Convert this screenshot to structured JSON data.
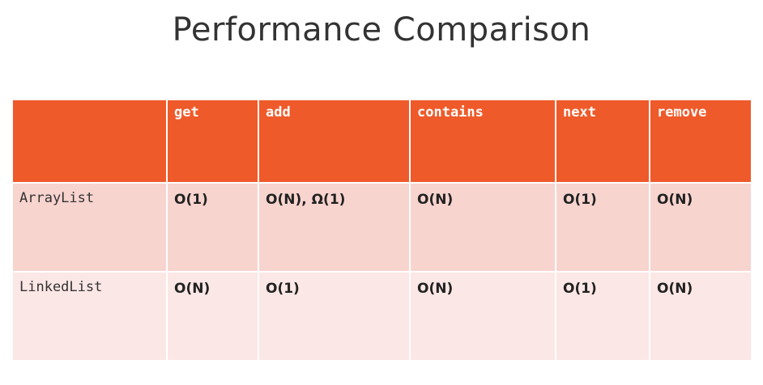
{
  "title": "Performance Comparison",
  "table": {
    "headers": [
      "",
      "get",
      "add",
      "contains",
      "next",
      "remove"
    ],
    "rows": [
      {
        "name": "ArrayList",
        "get": "O(1)",
        "add": "O(N), Ω(1)",
        "contains": "O(N)",
        "next": "O(1)",
        "remove": "O(N)"
      },
      {
        "name": "LinkedList",
        "get": "O(N)",
        "add": "O(1)",
        "contains": "O(N)",
        "next": "O(1)",
        "remove": "O(N)"
      }
    ]
  },
  "colors": {
    "header_bg": "#ef5a2a",
    "row_a_bg": "#f8d4cf",
    "row_b_bg": "#fbe7e5",
    "title_text": "#333333"
  }
}
